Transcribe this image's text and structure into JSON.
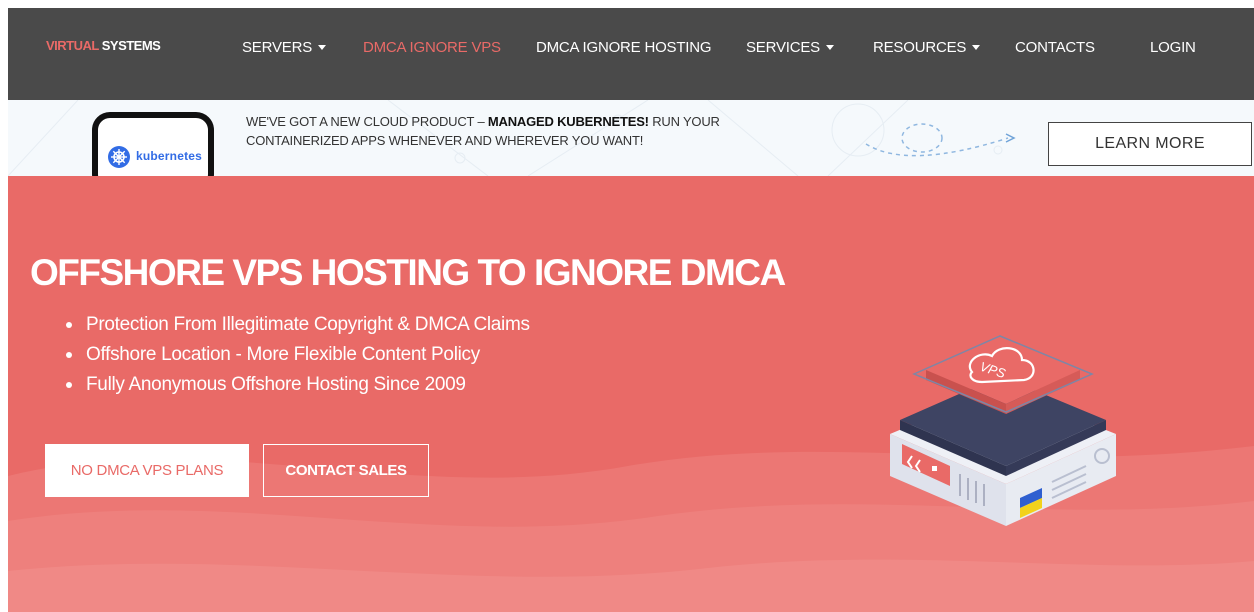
{
  "nav": {
    "logo_part1": "VIRTUAL",
    "logo_part2": " SYSTEMS",
    "items": [
      {
        "label": "SERVERS",
        "dropdown": true
      },
      {
        "label": "DMCA IGNORE VPS",
        "active": true
      },
      {
        "label": "DMCA IGNORE HOSTING"
      },
      {
        "label": "SERVICES",
        "dropdown": true
      },
      {
        "label": "RESOURCES",
        "dropdown": true
      },
      {
        "label": "CONTACTS"
      },
      {
        "label": "LOGIN"
      }
    ]
  },
  "banner": {
    "phone_label": "kubernetes",
    "msg_part1": "WE'VE GOT A NEW CLOUD PRODUCT – ",
    "msg_bold": "MANAGED KUBERNETES!",
    "msg_part2": " RUN YOUR CONTAINERIZED APPS WHENEVER AND WHEREVER YOU WANT!",
    "button_label": "LEARN MORE"
  },
  "hero": {
    "title": "OFFSHORE VPS HOSTING TO IGNORE DMCA",
    "bullets": [
      "Protection From Illegitimate Copyright & DMCA Claims",
      "Offshore Location - More Flexible Content Policy",
      "Fully Anonymous Offshore Hosting Since 2009"
    ],
    "primary_button": "NO DMCA VPS PLANS",
    "secondary_button": "CONTACT SALES",
    "server_label": "VPS"
  },
  "colors": {
    "accent": "#e96a67",
    "nav_bg": "#4a4a4a",
    "banner_bg": "#f5f9fc",
    "server_dark": "#3e4463",
    "server_light": "#eef0f6"
  },
  "icons": {
    "k8s": "kubernetes-wheel-icon",
    "cloud": "cloud-icon",
    "flag": "ukraine-flag-icon"
  }
}
